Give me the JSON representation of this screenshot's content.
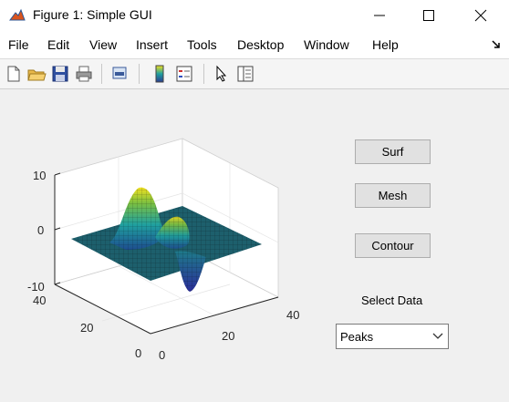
{
  "window": {
    "title": "Figure 1: Simple GUI",
    "controls": {
      "minimize": "minimize-icon",
      "maximize": "maximize-icon",
      "close": "close-icon"
    }
  },
  "menu": {
    "items": [
      "File",
      "Edit",
      "View",
      "Insert",
      "Tools",
      "Desktop",
      "Window",
      "Help"
    ],
    "dock_icon": "dock-arrow-icon"
  },
  "toolbar": {
    "icons": [
      "new-figure-icon",
      "open-file-icon",
      "save-icon",
      "print-icon",
      "link-plot-icon",
      "colorbar-icon",
      "legend-icon",
      "pointer-icon",
      "property-inspector-icon"
    ]
  },
  "axes": {
    "z_ticks": [
      "10",
      "0",
      "-10"
    ],
    "y_ticks": [
      "40",
      "20",
      "0"
    ],
    "x_ticks": [
      "0",
      "20",
      "40"
    ]
  },
  "controls": {
    "surf_label": "Surf",
    "mesh_label": "Mesh",
    "contour_label": "Contour",
    "select_label": "Select Data",
    "select_value": "Peaks"
  },
  "colors": {
    "surface_low": "#2b3c8f",
    "surface_mid": "#1fa0a0",
    "surface_high": "#f0e020"
  }
}
